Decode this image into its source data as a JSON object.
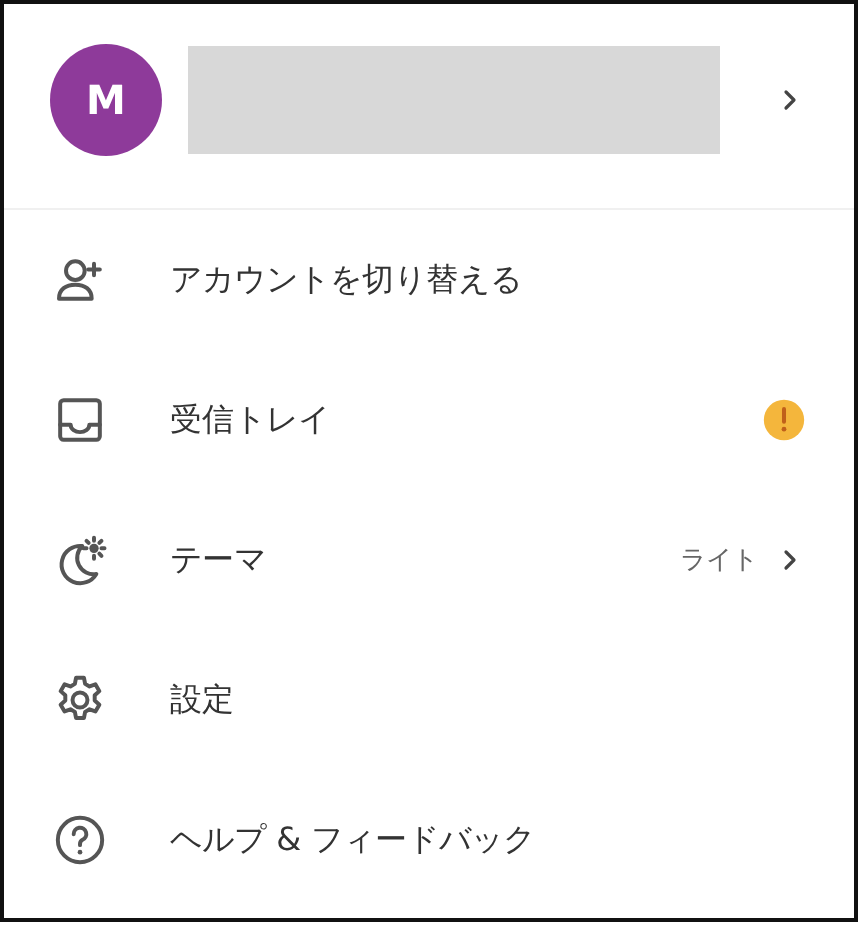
{
  "account": {
    "avatar_initial": "M",
    "color": "#8e3a9a",
    "name_redacted": true
  },
  "menu": [
    {
      "kind": "plain",
      "label": "アカウントを切り替える"
    },
    {
      "kind": "alert",
      "label": "受信トレイ"
    },
    {
      "kind": "submenu",
      "label": "テーマ",
      "value": "ライト"
    },
    {
      "kind": "plain",
      "label": "設定"
    },
    {
      "kind": "plain",
      "label": "ヘルプ & フィードバック"
    }
  ]
}
